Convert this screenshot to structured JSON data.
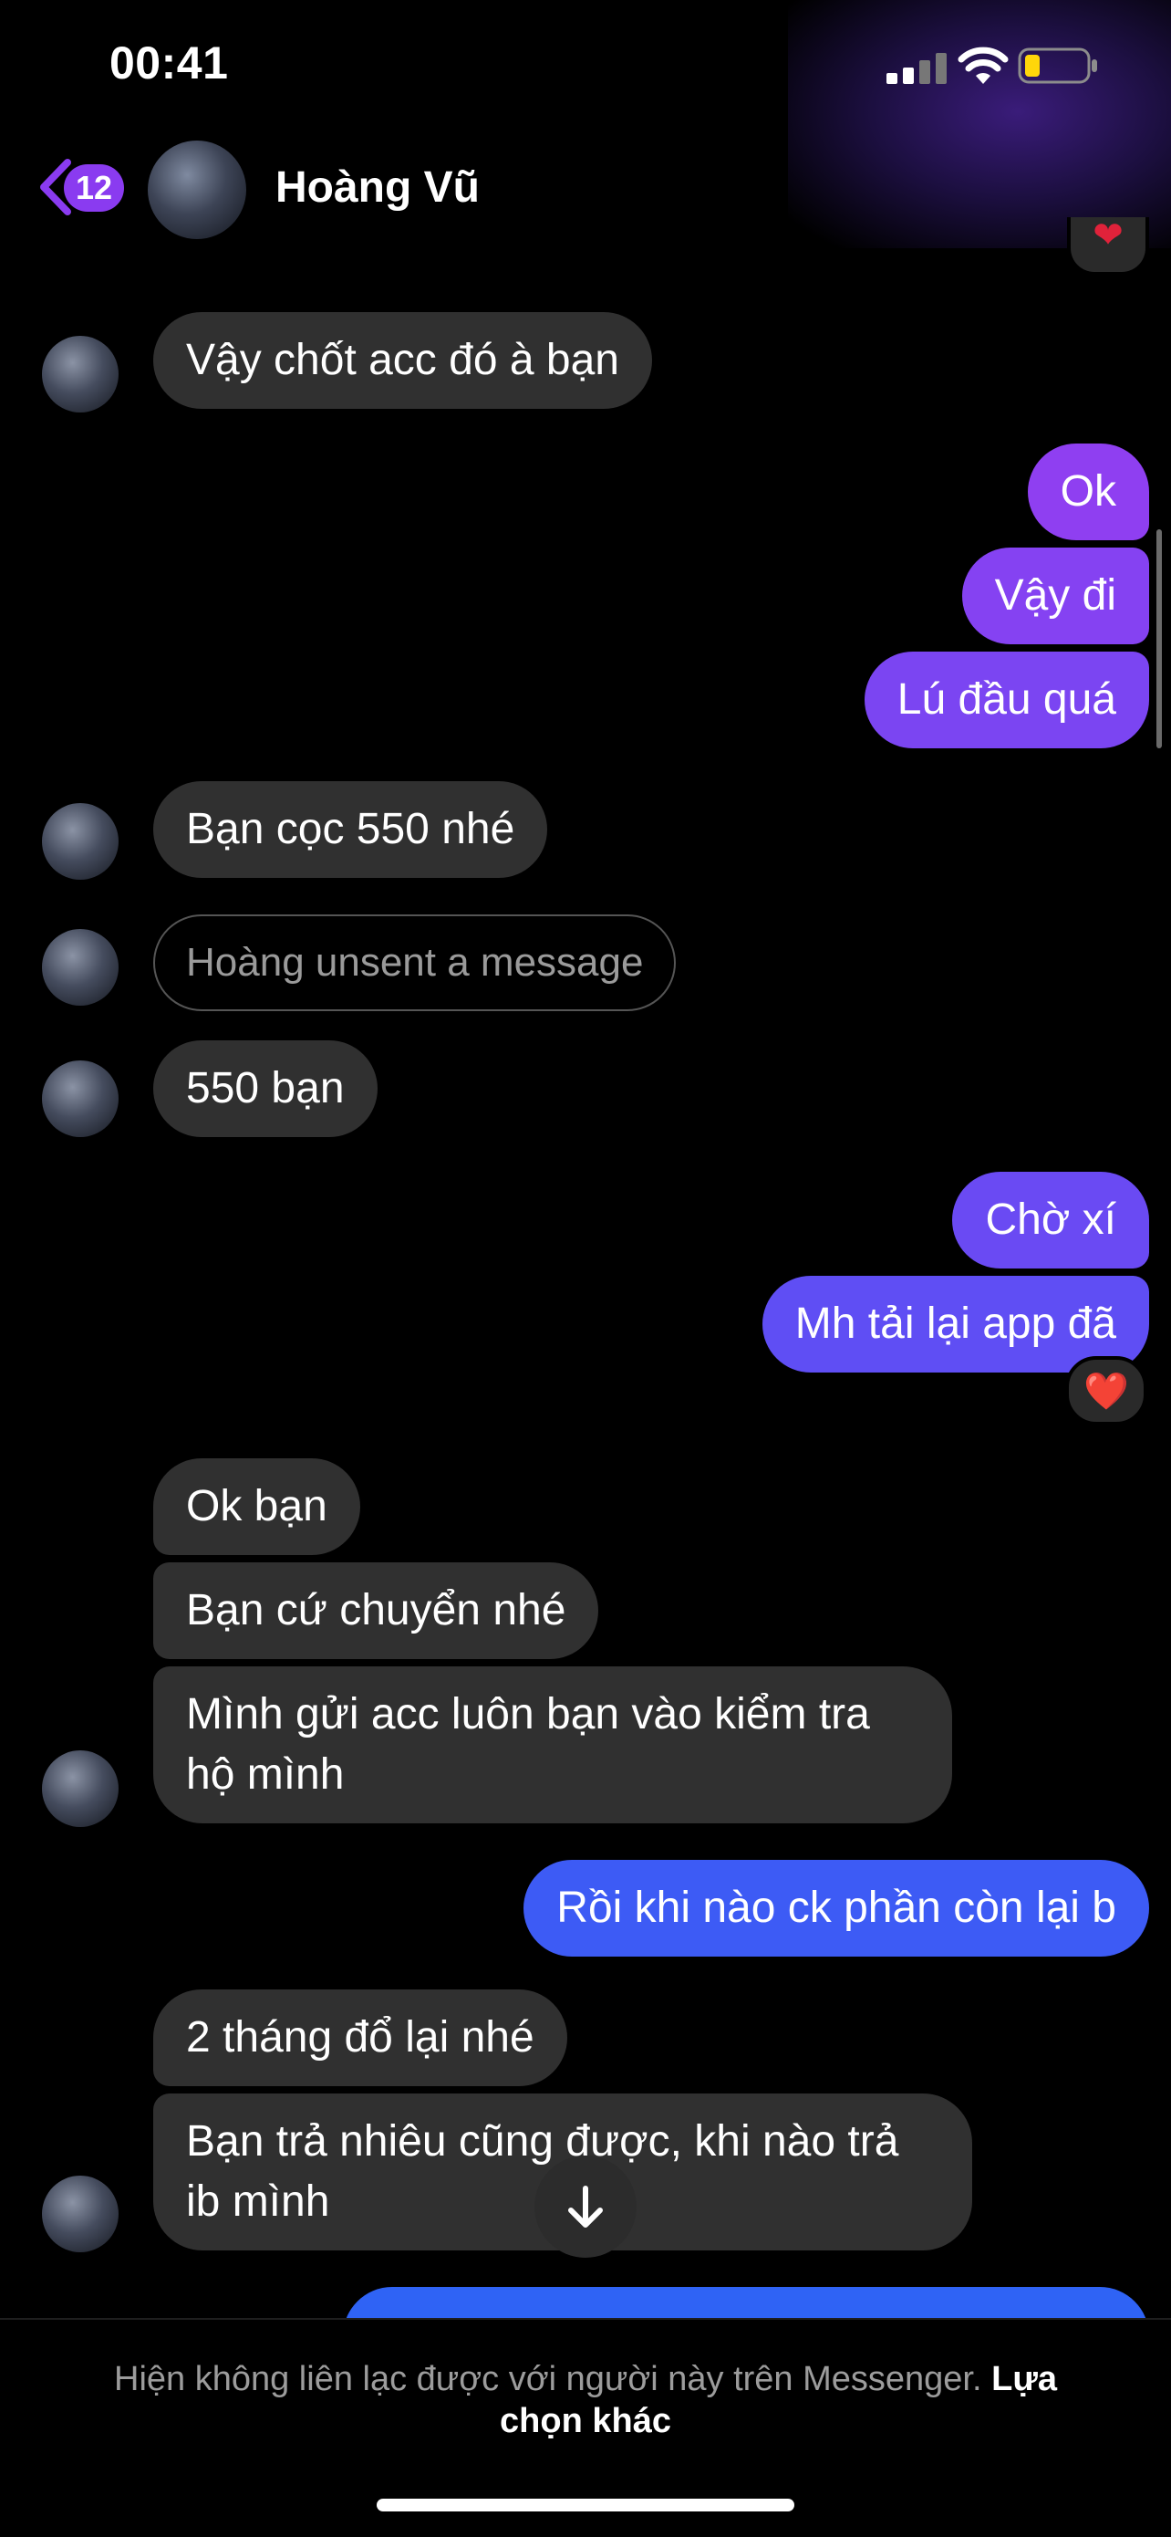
{
  "status_bar": {
    "time": "00:41"
  },
  "header": {
    "back_badge": "12",
    "contact_name": "Hoàng Vũ"
  },
  "messages": [
    {
      "text": "Vậy chốt acc đó à bạn"
    },
    {
      "text": "Ok"
    },
    {
      "text": "Vậy đi"
    },
    {
      "text": "Lú đầu quá"
    },
    {
      "text": "Bạn cọc 550 nhé"
    },
    {
      "text": "Hoàng unsent a message"
    },
    {
      "text": "550 bạn"
    },
    {
      "text": "Chờ xí"
    },
    {
      "text": "Mh tải lại app đã"
    },
    {
      "text": "Ok bạn"
    },
    {
      "text": "Bạn cứ chuyển nhé"
    },
    {
      "text": "Mình gửi acc luôn bạn vào kiểm tra",
      "text2": "hộ mình"
    },
    {
      "text": "Rồi khi nào ck phần còn lại b"
    },
    {
      "text": "2 tháng đổ lại nhé"
    },
    {
      "text": "Bạn trả nhiêu cũng được, khi nào trả",
      "text2": "ib mình"
    }
  ],
  "reaction": {
    "emoji": "❤️"
  },
  "footer": {
    "notice": "Hiện không liên lạc được với người này trên Messenger.",
    "link_line1": "Lựa",
    "link_line2": "chọn khác"
  },
  "colors": {
    "incoming_bubble": "#303030",
    "outgoing_gradient_top": "#8e3ff2",
    "outgoing_gradient_bottom": "#2f63f5",
    "badge": "#8a3bf0"
  },
  "icons": [
    "chevron-left-icon",
    "signal-icon",
    "wifi-icon",
    "battery-icon",
    "arrow-down-icon",
    "heart-icon"
  ]
}
